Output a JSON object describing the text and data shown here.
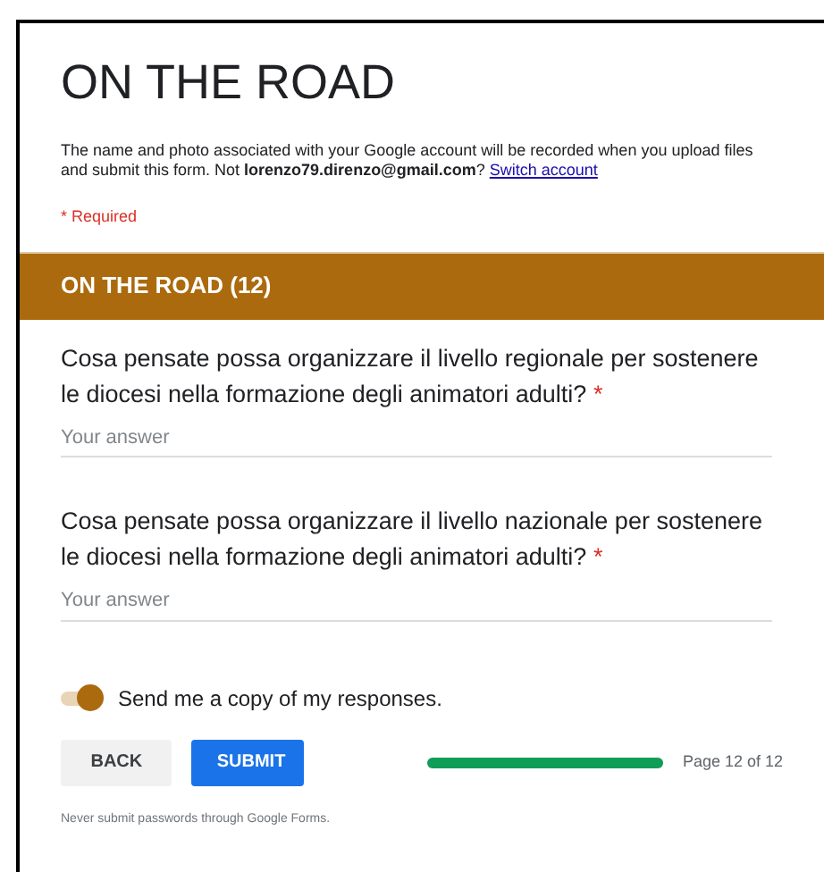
{
  "form": {
    "title": "ON THE ROAD",
    "notice": "The name and photo associated with your Google account will be recorded when you upload files and submit this form. Not **lorenzo79.direnzo@gmail.com**?",
    "switch_link": "Switch account",
    "required_note": "* Required"
  },
  "section": {
    "title": "ON THE ROAD (12)"
  },
  "questions": [
    {
      "text": "Cosa pensate possa organizzare il livello regionale per sostenere le diocesi nella formazione degli animatori adulti?",
      "required_mark": "*",
      "placeholder": "Your answer"
    },
    {
      "text": "Cosa pensate possa organizzare il livello nazionale per sostenere le diocesi nella formazione degli animatori adulti?",
      "required_mark": "*",
      "placeholder": "Your answer"
    }
  ],
  "copy_toggle": {
    "label": "Send me a copy of my responses.",
    "on": true
  },
  "buttons": [
    {
      "label": "BACK",
      "kind": "secondary"
    },
    {
      "label": "SUBMIT",
      "kind": "primary"
    }
  ],
  "progress": {
    "level": 1,
    "label": "Page 12 of 12"
  },
  "footer": "Never submit passwords through Google Forms."
}
